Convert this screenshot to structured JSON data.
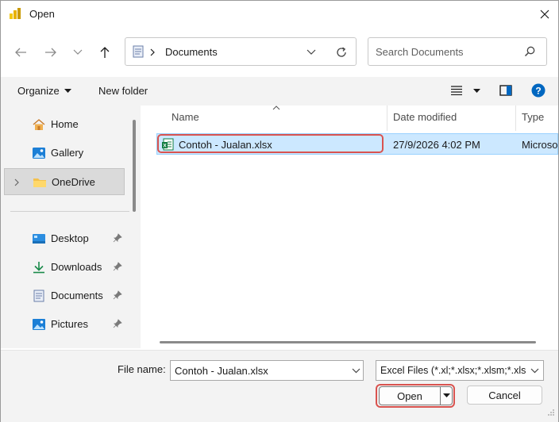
{
  "window": {
    "title": "Open"
  },
  "address": {
    "crumb": "Documents"
  },
  "search": {
    "placeholder": "Search Documents"
  },
  "toolbar": {
    "organize": "Organize",
    "new_folder": "New folder"
  },
  "sidebar": {
    "items": [
      {
        "label": "Home",
        "icon": "home-icon"
      },
      {
        "label": "Gallery",
        "icon": "gallery-icon"
      },
      {
        "label": "OneDrive",
        "icon": "folder-icon",
        "selected": true
      },
      {
        "label": "Desktop",
        "icon": "desktop-icon",
        "pinned": true
      },
      {
        "label": "Downloads",
        "icon": "download-icon",
        "pinned": true
      },
      {
        "label": "Documents",
        "icon": "document-icon",
        "pinned": true
      },
      {
        "label": "Pictures",
        "icon": "pictures-icon",
        "pinned": true
      }
    ]
  },
  "columns": {
    "name": "Name",
    "date": "Date modified",
    "type": "Type"
  },
  "files": [
    {
      "name": "Contoh - Jualan.xlsx",
      "date": "27/9/2026 4:02 PM",
      "type": "Microso",
      "selected": true
    }
  ],
  "footer": {
    "file_name_label": "File name:",
    "file_name_value": "Contoh - Jualan.xlsx",
    "file_type": "Excel Files (*.xl;*.xlsx;*.xlsm;*.xls",
    "open": "Open",
    "cancel": "Cancel"
  },
  "colors": {
    "accent": "#0067c0",
    "selection": "#cce8ff",
    "highlight": "#d9534f",
    "excel": "#107c41"
  }
}
